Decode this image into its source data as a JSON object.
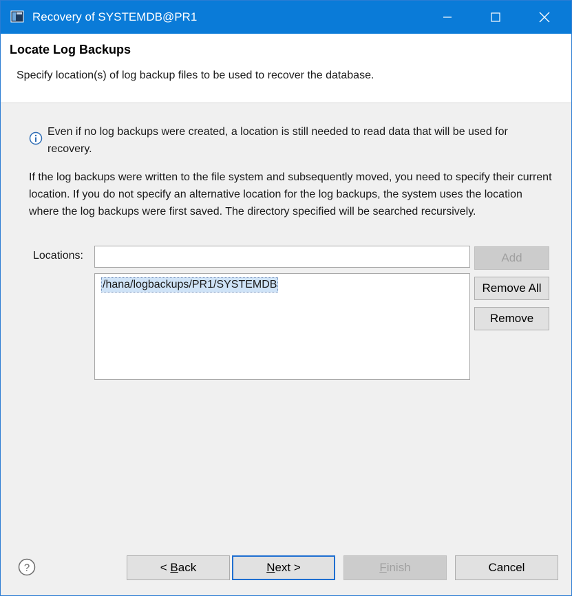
{
  "window": {
    "title": "Recovery of SYSTEMDB@PR1",
    "accent_color": "#0a7bd8"
  },
  "header": {
    "title": "Locate Log Backups",
    "description": "Specify location(s) of log backup files to be used to recover the database."
  },
  "info": {
    "icon": "info-icon",
    "text": "Even if no log backups were created, a location is still needed to read data that will be used for recovery."
  },
  "paragraph": "If the log backups were written to the file system and subsequently moved, you need to specify their current location. If you do not specify an alternative location for the log backups, the system uses the location where the log backups were first saved. The directory specified will be searched recursively.",
  "locations": {
    "label": "Locations:",
    "input_value": "",
    "items": [
      "/hana/logbackups/PR1/SYSTEMDB"
    ],
    "add_label": "Add",
    "remove_all_label": "Remove All",
    "remove_label": "Remove"
  },
  "footer": {
    "help_icon": "help-icon",
    "back_label_pre": "< ",
    "back_label_mnemonic": "B",
    "back_label_post": "ack",
    "next_label_mnemonic": "N",
    "next_label_post": "ext >",
    "finish_label_mnemonic": "F",
    "finish_label_post": "inish",
    "cancel_label": "Cancel"
  }
}
